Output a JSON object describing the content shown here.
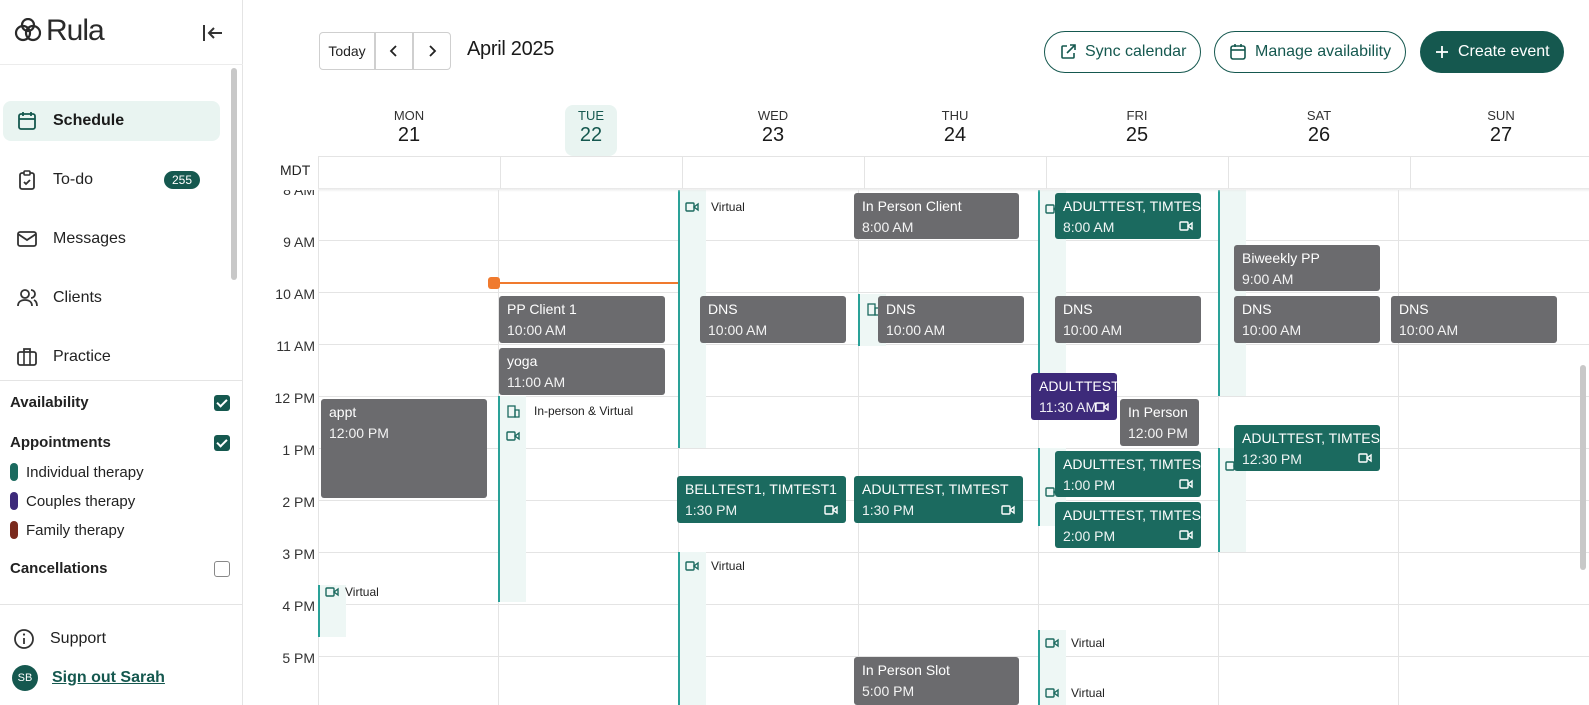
{
  "app": {
    "logo": "Rula"
  },
  "sidebar": {
    "items": [
      {
        "label": "Schedule",
        "icon": "calendar-icon",
        "active": true
      },
      {
        "label": "To-do",
        "icon": "clipboard-icon",
        "badge": "255"
      },
      {
        "label": "Messages",
        "icon": "mail-icon"
      },
      {
        "label": "Clients",
        "icon": "users-icon"
      },
      {
        "label": "Practice",
        "icon": "briefcase-icon"
      }
    ],
    "filters": {
      "availability": "Availability",
      "appointments": "Appointments",
      "legend": [
        {
          "label": "Individual therapy",
          "color": "#1b6a5f"
        },
        {
          "label": "Couples therapy",
          "color": "#3d2a7a"
        },
        {
          "label": "Family therapy",
          "color": "#7a2a1e"
        }
      ],
      "cancellations": "Cancellations"
    },
    "support": "Support",
    "signout": "Sign out Sarah",
    "avatar": "SB"
  },
  "toolbar": {
    "today": "Today",
    "month": "April 2025",
    "sync": "Sync calendar",
    "manage": "Manage availability",
    "create": "Create event"
  },
  "calendar": {
    "timezone": "MDT",
    "days": [
      {
        "dow": "MON",
        "num": "21"
      },
      {
        "dow": "TUE",
        "num": "22"
      },
      {
        "dow": "WED",
        "num": "23"
      },
      {
        "dow": "THU",
        "num": "24"
      },
      {
        "dow": "FRI",
        "num": "25"
      },
      {
        "dow": "SAT",
        "num": "26"
      },
      {
        "dow": "SUN",
        "num": "27"
      }
    ],
    "hours": [
      "8 AM",
      "9 AM",
      "10 AM",
      "11 AM",
      "12 PM",
      "1 PM",
      "2 PM",
      "3 PM",
      "4 PM",
      "5 PM"
    ],
    "availability_labels": {
      "virtual": "Virtual",
      "in_person_virtual": "In-person & Virtual"
    },
    "events": {
      "thu_inperson_client": {
        "title": "In Person Client",
        "time": "8:00 AM"
      },
      "fri_adult_8": {
        "title": "ADULTTEST, TIMTEST",
        "time": "8:00 AM"
      },
      "sat_biweekly": {
        "title": "Biweekly PP",
        "time": "9:00 AM"
      },
      "tue_pp_client": {
        "title": "PP Client 1",
        "time": "10:00 AM"
      },
      "wed_dns": {
        "title": "DNS",
        "time": "10:00 AM"
      },
      "thu_dns": {
        "title": "DNS",
        "time": "10:00 AM"
      },
      "fri_dns": {
        "title": "DNS",
        "time": "10:00 AM"
      },
      "sat_dns": {
        "title": "DNS",
        "time": "10:00 AM"
      },
      "sun_dns": {
        "title": "DNS",
        "time": "10:00 AM"
      },
      "tue_yoga": {
        "title": "yoga",
        "time": "11:00 AM"
      },
      "fri_couples": {
        "title": "ADULTTEST",
        "time": "11:30 AM"
      },
      "fri_inperson": {
        "title": "In Person",
        "time": "12:00 PM"
      },
      "mon_appt": {
        "title": "appt",
        "time": "12:00 PM"
      },
      "sat_adult_1230": {
        "title": "ADULTTEST, TIMTEST",
        "time": "12:30 PM"
      },
      "fri_adult_1": {
        "title": "ADULTTEST, TIMTEST",
        "time": "1:00 PM"
      },
      "wed_bell": {
        "title": "BELLTEST1, TIMTEST1",
        "time": "1:30 PM"
      },
      "thu_adult_130": {
        "title": "ADULTTEST, TIMTEST",
        "time": "1:30 PM"
      },
      "fri_adult_2": {
        "title": "ADULTTEST, TIMTEST",
        "time": "2:00 PM"
      },
      "thu_inperson_slot": {
        "title": "In Person Slot",
        "time": "5:00 PM"
      }
    }
  }
}
